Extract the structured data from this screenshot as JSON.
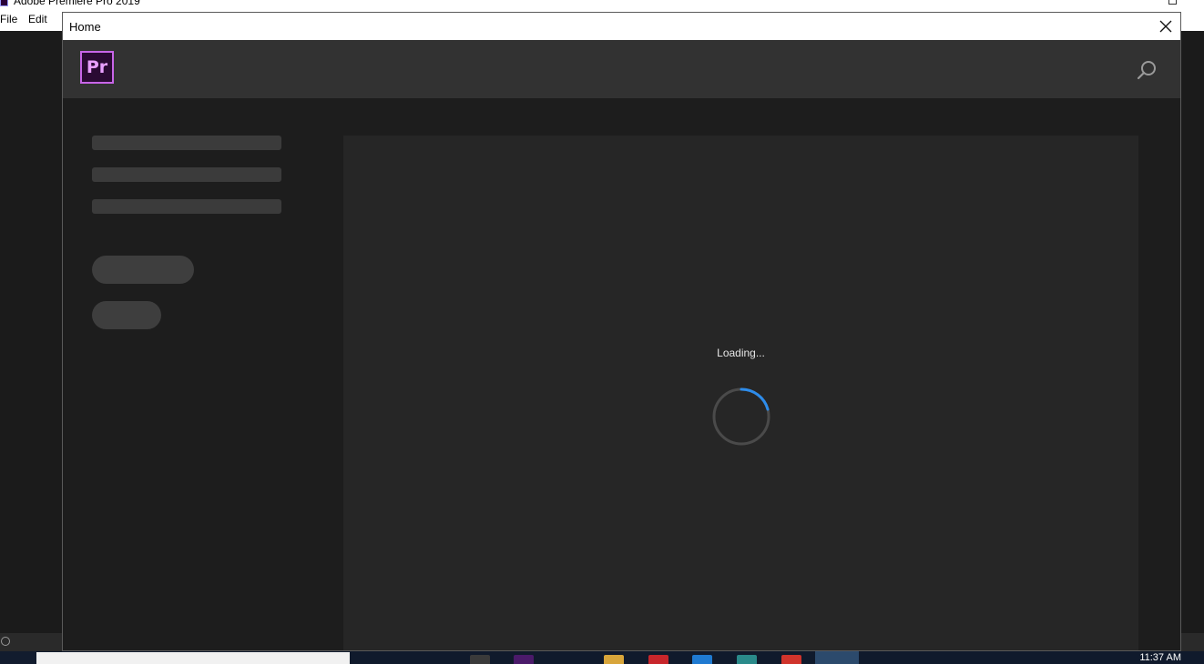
{
  "app": {
    "title": "Adobe Premiere Pro 2019",
    "menu": [
      "File",
      "Edit"
    ]
  },
  "home": {
    "title": "Home",
    "logo_text": "Pr",
    "loading_text": "Loading..."
  },
  "taskbar": {
    "clock": "11:37 AM"
  },
  "colors": {
    "accent_blue": "#2d8ceb",
    "premiere_purple": "#c865e8",
    "header_bg": "#323232",
    "panel_bg": "#262626"
  }
}
